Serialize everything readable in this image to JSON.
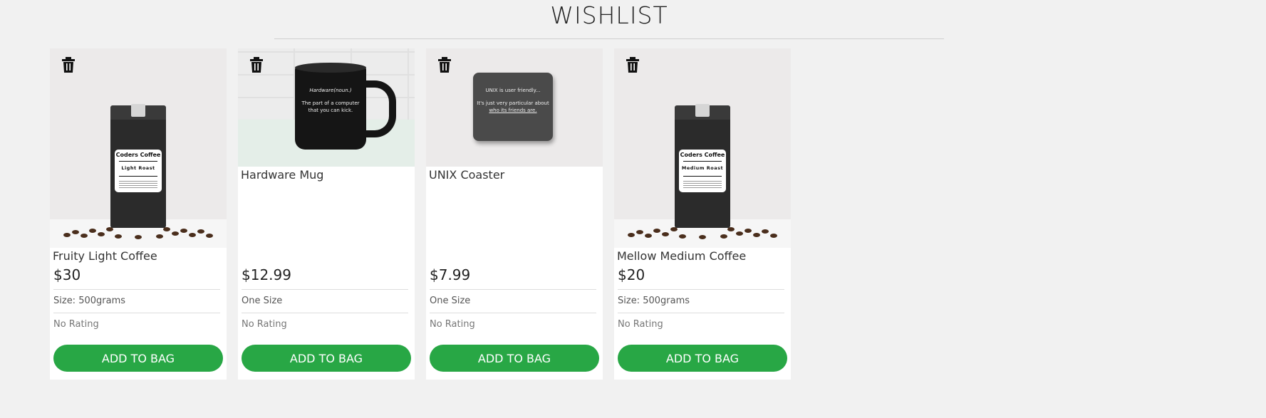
{
  "page": {
    "title": "WISHLIST"
  },
  "products": [
    {
      "name": "Fruity Light Coffee",
      "price": "$30",
      "size": "Size: 500grams",
      "rating": "No Rating",
      "button": "ADD TO BAG",
      "image": {
        "type": "coffee-bag",
        "brand": "Coders Coffee",
        "roast": "Light Roast"
      }
    },
    {
      "name": "Hardware Mug",
      "price": "$12.99",
      "size": "One Size",
      "rating": "No Rating",
      "button": "ADD TO BAG",
      "image": {
        "type": "mug",
        "heading": "Hardware(noun.)",
        "body": "The part of a computer that you can kick."
      }
    },
    {
      "name": "UNIX Coaster",
      "price": "$7.99",
      "size": "One Size",
      "rating": "No Rating",
      "button": "ADD TO BAG",
      "image": {
        "type": "coaster",
        "line1": "UNIX is user friendly...",
        "line2": "It's just very particular about",
        "line3": "who its friends are."
      }
    },
    {
      "name": "Mellow Medium Coffee",
      "price": "$20",
      "size": "Size: 500grams",
      "rating": "No Rating",
      "button": "ADD TO BAG",
      "image": {
        "type": "coffee-bag",
        "brand": "Coders Coffee",
        "roast": "Medium Roast"
      }
    }
  ],
  "icons": {
    "remove": "trash-icon"
  },
  "colors": {
    "accent": "#28a745",
    "background": "#f1f1f1",
    "card": "#ffffff"
  }
}
